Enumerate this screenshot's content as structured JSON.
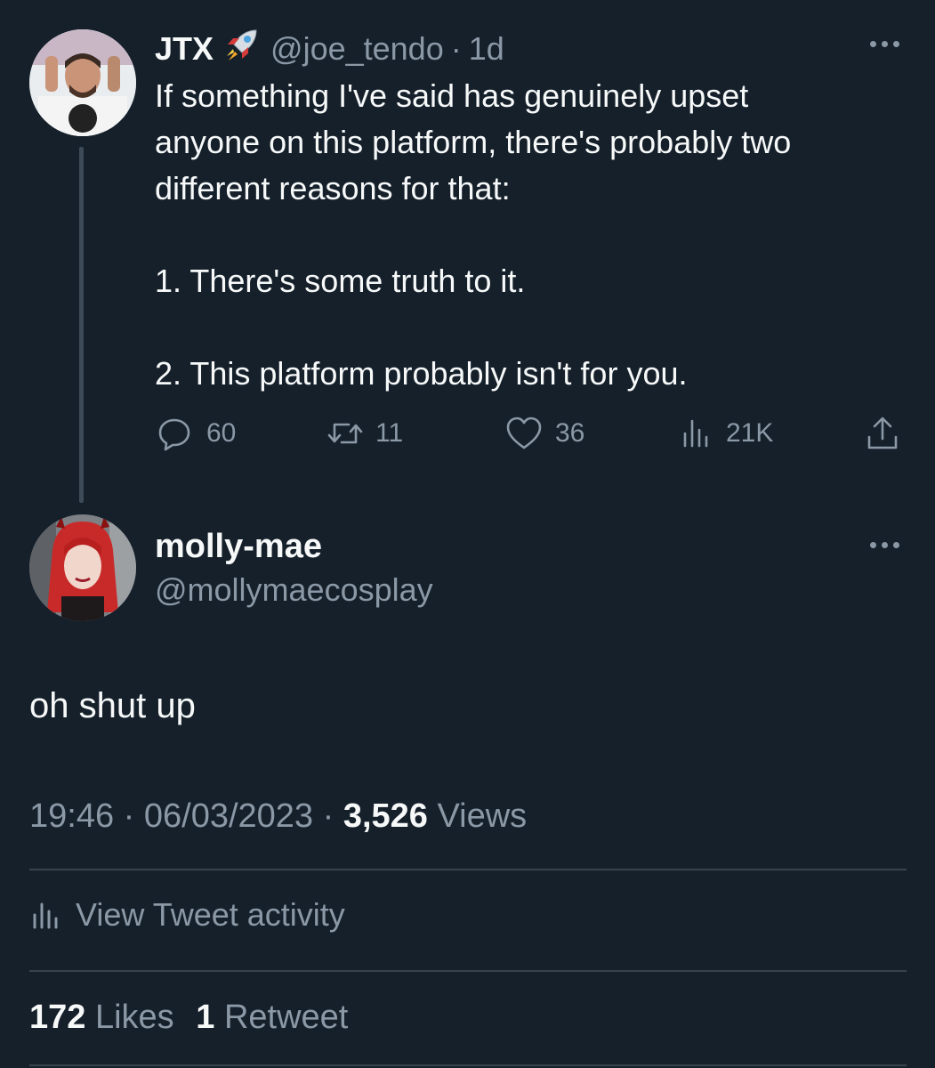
{
  "parent_tweet": {
    "name": "JTX",
    "name_icon": "rocket-icon",
    "handle": "@joe_tendo",
    "separator": "·",
    "time": "1d",
    "lines": [
      "If something I've said has genuinely upset",
      "anyone on this platform, there's probably two",
      "different reasons for that:"
    ],
    "point_1": "1. There's some truth to it.",
    "point_2": "2. This platform probably isn't for you.",
    "stats": {
      "replies": "60",
      "retweets": "11",
      "likes": "36",
      "views": "21K"
    }
  },
  "reply": {
    "name": "molly-mae",
    "handle": "@mollymaecosplay",
    "text": "oh shut up",
    "time": "19:46",
    "sep1": "·",
    "date": "06/03/2023",
    "sep2": "·",
    "view_count": "3,526",
    "view_label": "Views",
    "activity_label": "View Tweet activity",
    "likes_count": "172",
    "likes_label": "Likes",
    "retweet_count": "1",
    "retweet_label": "Retweet"
  },
  "colors": {
    "background": "#15202b",
    "text": "#f7f9f9",
    "muted": "#8b98a5",
    "divider": "#38444d"
  }
}
